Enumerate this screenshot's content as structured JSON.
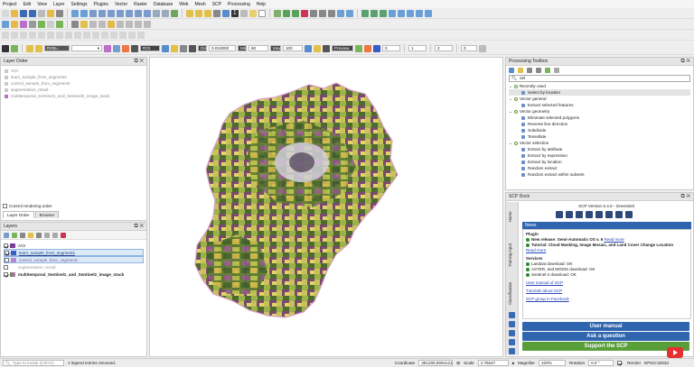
{
  "menubar": [
    "Project",
    "Edit",
    "View",
    "Layer",
    "Settings",
    "Plugins",
    "Vector",
    "Raster",
    "Database",
    "Web",
    "Mesh",
    "SCP",
    "Processing",
    "Help"
  ],
  "toolbar3": {
    "roi_label": "ROI",
    "roi_value": "",
    "dist_label": "Dist",
    "dist_value": "0.010000",
    "min_label": "Min",
    "min_value": "60",
    "max_label": "Max",
    "max_value": "100",
    "preview_label": "Preview",
    "spin1": "0",
    "spin2": "1",
    "spin3": "2",
    "spin4": "0"
  },
  "layer_order": {
    "title": "Layer Order",
    "items": [
      "AOI",
      "learn_sample_from_segments",
      "control_sample_from_segments",
      "segmentation_result",
      "multitemporal_Sentinel1_and_Sentinel2_image_stack"
    ],
    "control_rendering": "Control rendering order",
    "tabs": [
      "Layer Order",
      "Browser"
    ]
  },
  "layers": {
    "title": "Layers",
    "items": [
      {
        "label": "AOI",
        "checked": true,
        "color": "#7b3a97",
        "style": "normal"
      },
      {
        "label": "learn_sample_from_segments",
        "checked": true,
        "color": "#3a5cc9",
        "style": "selected"
      },
      {
        "label": "control_sample_from_segments",
        "checked": false,
        "color": "#b38ad1",
        "style": "selected2"
      },
      {
        "label": "segmentation_result",
        "checked": false,
        "color": "",
        "style": "grey"
      },
      {
        "label": "multitemporal_Sentinel1_and_Sentinel2_image_stack",
        "checked": true,
        "color": "",
        "style": "bold"
      }
    ]
  },
  "processing": {
    "title": "Processing Toolbox",
    "search": "sel",
    "groups": [
      {
        "name": "Recently used",
        "items": [
          "Select by location"
        ]
      },
      {
        "name": "Vector general",
        "items": [
          "Extract selected features"
        ]
      },
      {
        "name": "Vector geometry",
        "items": [
          "Eliminate selected polygons",
          "Reverse line direction",
          "Subdivide",
          "Tessellate"
        ]
      },
      {
        "name": "Vector selection",
        "items": [
          "Extract by attribute",
          "Extract by expression",
          "Extract by location",
          "Random extract",
          "Random extract within subsets"
        ]
      }
    ]
  },
  "scp": {
    "title": "SCP Dock",
    "version": "SCP Version 6.4.0 - Greenbelt",
    "side_tabs": [
      "Home",
      "Training input",
      "Classification"
    ],
    "news_header": "News",
    "plugin_label": "Plugin",
    "news1_prefix": "New release: Semi-Automatic OS v. 6",
    "news1_link": "Read more",
    "news2": "Tutorial: Cloud Masking, Image Mosaic, and Land Cover Change Location",
    "news2_link": "Read more",
    "services_label": "Services",
    "services": [
      "Landsat download: OK",
      "ASTER, and MODIS download: OK",
      "Sentinel-2 download: OK"
    ],
    "links": [
      "User manual of SCP",
      "Tutorials about SCP",
      "SCP group in Facebook"
    ],
    "buttons": [
      "User manual",
      "Ask a question",
      "Support the SCP"
    ]
  },
  "status": {
    "locate_placeholder": "Type to locate (Ctrl+K)",
    "message": "1 legend entries removed.",
    "coord_label": "Coordinate",
    "coord": "381289,5994121",
    "scale_label": "Scale",
    "scale": "1:76647",
    "magnifier_label": "Magnifier",
    "magnifier": "100%",
    "rotation_label": "Rotation",
    "rotation": "0.0 °",
    "render_label": "Render",
    "crs": "EPSG:32633"
  },
  "colors": {
    "accent": "#2f64ae",
    "green": "#5a9e3a",
    "map_bg": "#ffffff"
  }
}
